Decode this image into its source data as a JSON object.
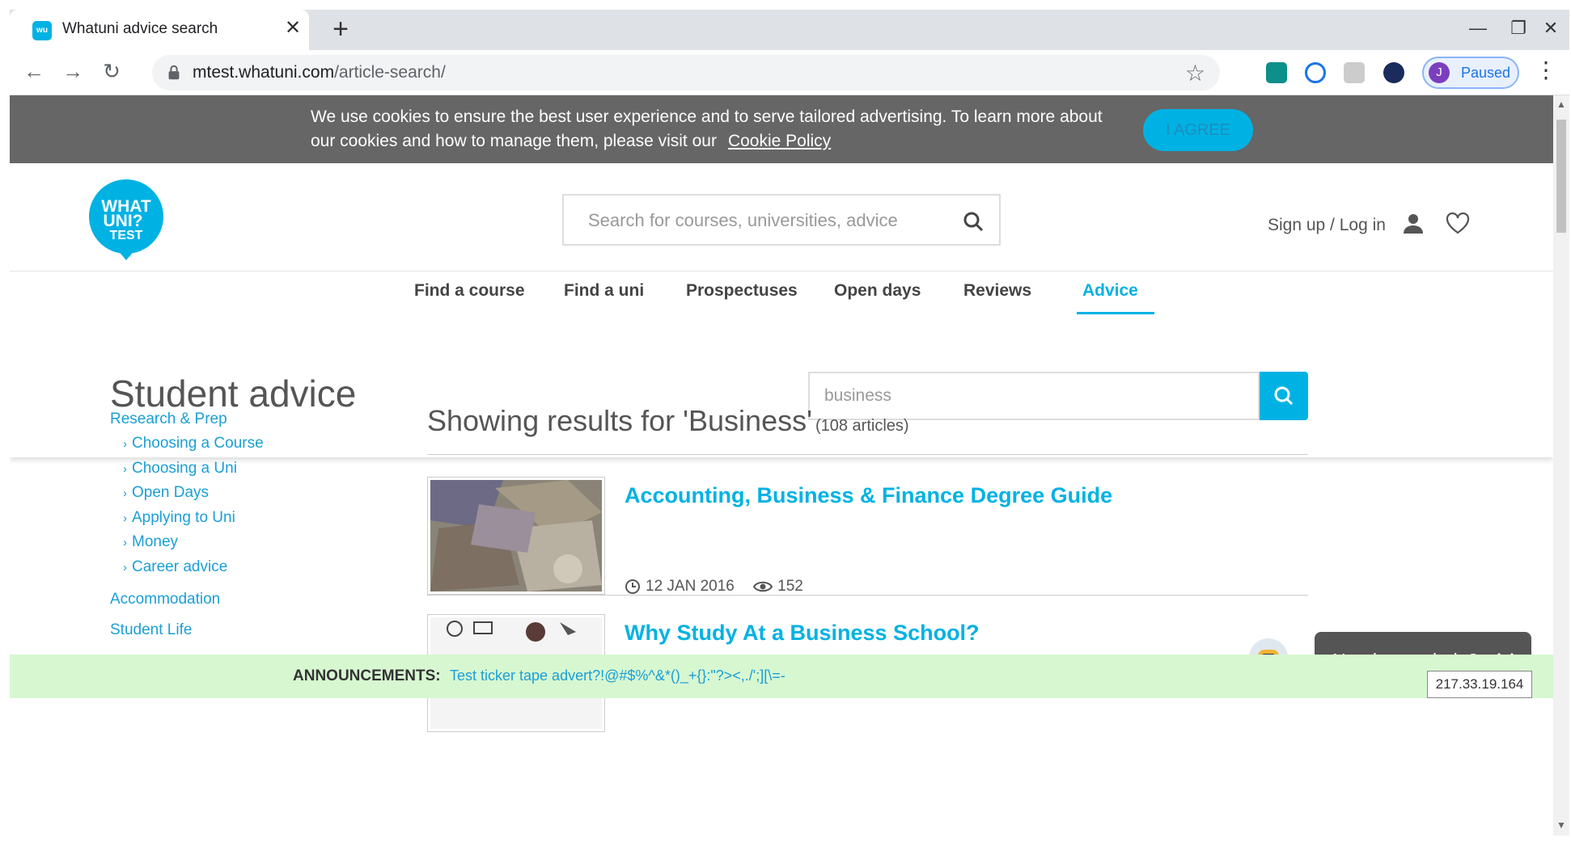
{
  "browser": {
    "tab_title": "Whatuni advice search",
    "tab_favicon_text": "wu",
    "url_host": "mtest.whatuni.com",
    "url_path": "/article-search/",
    "profile_initial": "J",
    "profile_status": "Paused"
  },
  "cookie_banner": {
    "text": "We use cookies to ensure the best user experience and to serve tailored advertising. To learn more about our cookies and how to manage them, please visit our",
    "link": "Cookie Policy",
    "agree_label": "I AGREE"
  },
  "header": {
    "logo_lines": [
      "WHAT",
      "UNI?",
      "TEST"
    ],
    "search_placeholder": "Search for courses, universities, advice",
    "signup_label": "Sign up / Log in"
  },
  "main_nav": {
    "items": [
      {
        "label": "Find a course"
      },
      {
        "label": "Find a uni"
      },
      {
        "label": "Prospectuses"
      },
      {
        "label": "Open days"
      },
      {
        "label": "Reviews"
      },
      {
        "label": "Advice",
        "active": true
      }
    ]
  },
  "advice": {
    "title": "Student advice",
    "search_value": "business"
  },
  "sidebar": {
    "head1": "Research & Prep",
    "sub_items": [
      "Choosing a Course",
      "Choosing a Uni",
      "Open Days",
      "Applying to Uni",
      "Money",
      "Career advice"
    ],
    "head2": "Accommodation",
    "head3": "Student Life"
  },
  "results": {
    "heading": "Showing results for 'Business'",
    "count": "(108 articles)",
    "articles": [
      {
        "title": "Accounting, Business & Finance Degree Guide",
        "date": "12 JAN 2016",
        "views": "152"
      },
      {
        "title": "Why Study At a Business School?"
      }
    ]
  },
  "help_widget": {
    "text": "Need some help?"
  },
  "ticker": {
    "label": "ANNOUNCEMENTS:",
    "text": "Test ticker tape advert?!@#$%^&*()_+{}:\"?><,./';][\\=-",
    "ip": "217.33.19.164"
  },
  "colors": {
    "brand": "#00b2e3",
    "cookie_bg": "#666666",
    "ticker_bg": "#d7f7d1"
  }
}
